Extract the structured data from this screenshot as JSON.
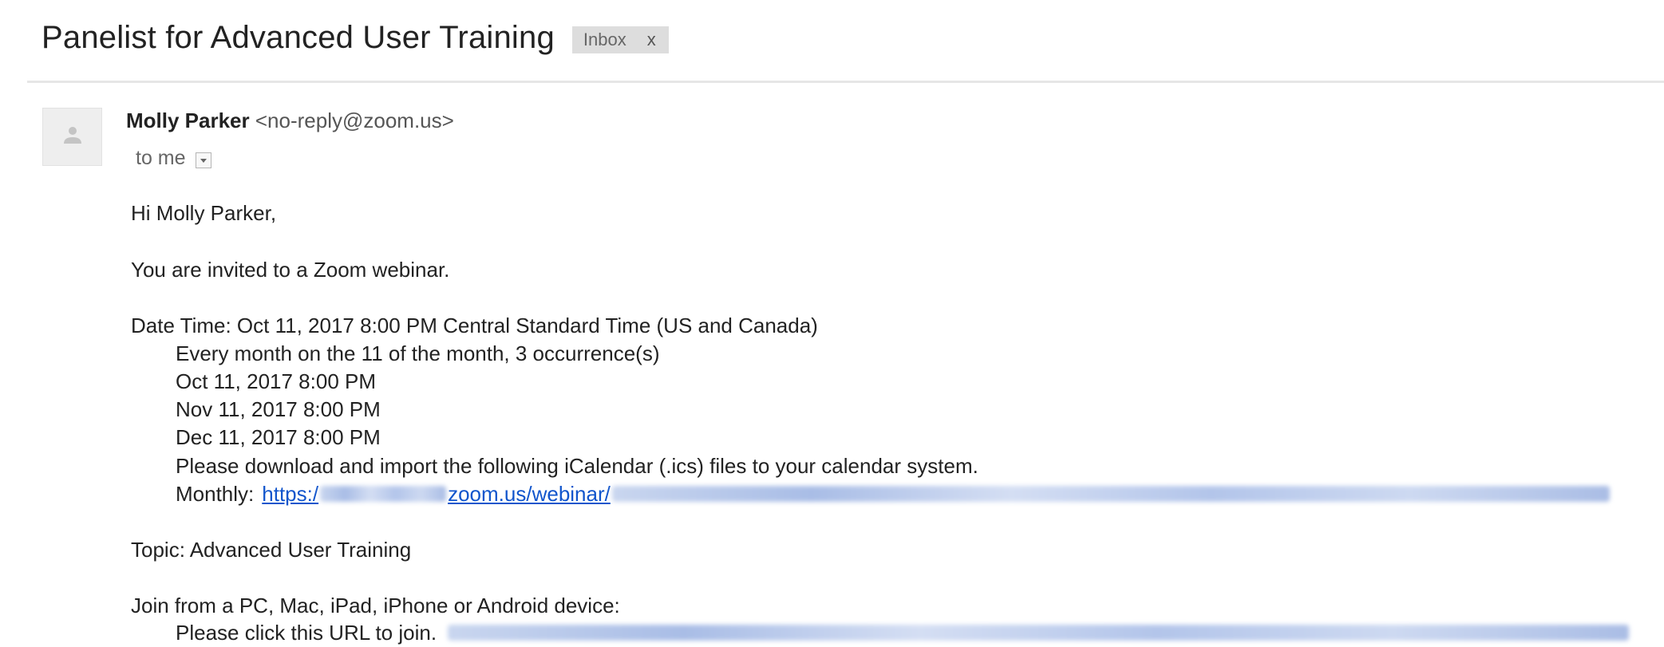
{
  "email": {
    "subject": "Panelist for Advanced User Training",
    "label": {
      "name": "Inbox",
      "remove": "x"
    },
    "sender": {
      "name": "Molly Parker",
      "email": "<no-reply@zoom.us>"
    },
    "recipient": "to me",
    "body": {
      "greeting": "Hi Molly Parker,",
      "invitation": "You are invited to a Zoom webinar.",
      "date_time": "Date Time: Oct 11, 2017 8:00 PM Central Standard Time (US and Canada)",
      "recurrence": "Every month on the 11 of the month, 3 occurrence(s)",
      "occurrences": [
        "Oct 11, 2017 8:00 PM",
        "Nov 11, 2017 8:00 PM",
        "Dec 11, 2017 8:00 PM"
      ],
      "ics_note": "Please download and import the following iCalendar (.ics) files to your calendar system.",
      "monthly_label": "Monthly:",
      "monthly_link_start": "https:/",
      "monthly_link_mid": "zoom.us/webinar/",
      "topic": "Topic: Advanced User Training",
      "join_heading": "Join from a PC, Mac, iPad, iPhone or Android device:",
      "join_instruction": "Please click this URL to join."
    }
  },
  "colors": {
    "link": "#1155cc",
    "chip_bg": "#dddddd",
    "text": "#222222"
  },
  "icons": {
    "avatar": "default-avatar-icon",
    "details": "chevron-down-icon"
  }
}
